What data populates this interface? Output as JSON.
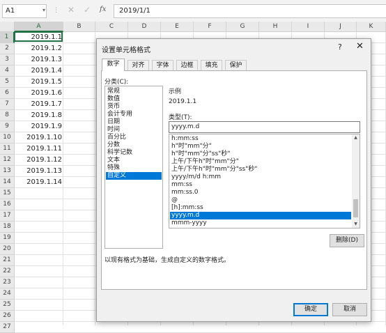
{
  "formula_bar": {
    "name_box": "A1",
    "name_box_icon": "chevron-down-icon",
    "separator": "⋮",
    "cancel_glyph": "✕",
    "enter_glyph": "✓",
    "fx_label": "fx",
    "formula_value": "2019/1/1"
  },
  "sheet": {
    "columns": [
      "A",
      "B",
      "C",
      "D",
      "E",
      "F",
      "G",
      "H",
      "I",
      "J",
      "K"
    ],
    "selected_column": "A",
    "rows": [
      "1",
      "2",
      "3",
      "4",
      "5",
      "6",
      "7",
      "8",
      "9",
      "10",
      "11",
      "12",
      "13",
      "14",
      "15",
      "16",
      "17",
      "18",
      "19",
      "20",
      "21",
      "22",
      "23",
      "24",
      "25",
      "26",
      "27"
    ],
    "selected_row": "1",
    "column_a_values": [
      "2019.1.1",
      "2019.1.2",
      "2019.1.3",
      "2019.1.4",
      "2019.1.5",
      "2019.1.6",
      "2019.1.7",
      "2019.1.8",
      "2019.1.9",
      "2019.1.10",
      "2019.1.11",
      "2019.1.12",
      "2019.1.13",
      "2019.1.14"
    ],
    "selection_color": "#217346"
  },
  "dialog": {
    "title": "设置单元格格式",
    "help_glyph": "?",
    "close_glyph": "✕",
    "tabs": [
      "数字",
      "对齐",
      "字体",
      "边框",
      "填充",
      "保护"
    ],
    "active_tab": "数字",
    "category_label": "分类(C):",
    "categories": [
      "常规",
      "数值",
      "货币",
      "会计专用",
      "日期",
      "时间",
      "百分比",
      "分数",
      "科学记数",
      "文本",
      "特殊",
      "自定义"
    ],
    "selected_category": "自定义",
    "sample_label": "示例",
    "sample_value": "2019.1.1",
    "type_label": "类型(T):",
    "type_value": "yyyy.m.d",
    "format_list": [
      "h:mm:ss",
      "h\"时\"mm\"分\"",
      "h\"时\"mm\"分\"ss\"秒\"",
      "上午/下午h\"时\"mm\"分\"",
      "上午/下午h\"时\"mm\"分\"ss\"秒\"",
      "yyyy/m/d h:mm",
      "mm:ss",
      "mm:ss.0",
      "@",
      "[h]:mm:ss",
      "yyyy.m.d",
      "mmm-yyyy"
    ],
    "selected_format": "yyyy.m.d",
    "delete_button": "删除(D)",
    "description": "以现有格式为基础，生成自定义的数字格式。",
    "ok_button": "确定",
    "cancel_button": "取消",
    "accent_color": "#0078d7"
  }
}
